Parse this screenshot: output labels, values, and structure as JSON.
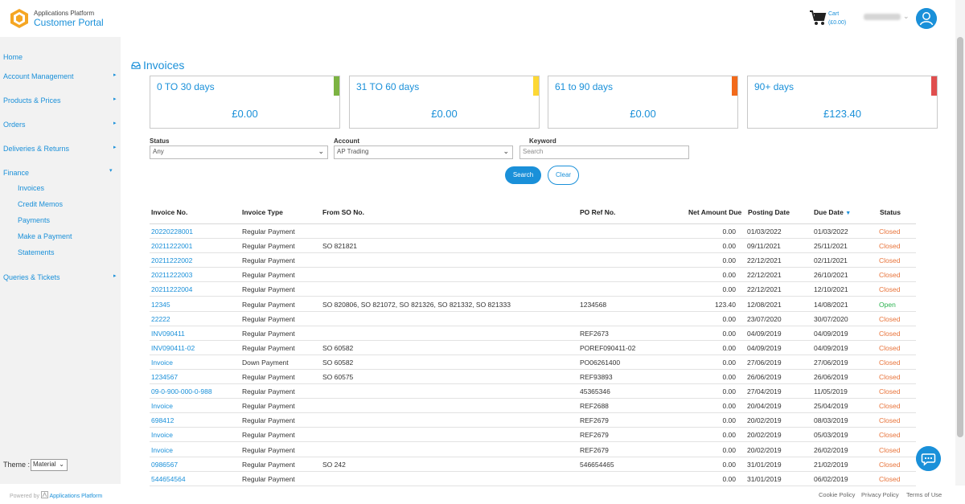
{
  "header": {
    "brand_small": "Applications Platform",
    "brand_big": "Customer Portal",
    "cart_label": "Cart",
    "cart_amount": "(£0.00)"
  },
  "sidebar": {
    "items": [
      {
        "label": "Home",
        "has_arrow": false
      },
      {
        "label": "Account Management",
        "has_arrow": true
      },
      {
        "label": "Products & Prices",
        "has_arrow": true
      },
      {
        "label": "Orders",
        "has_arrow": true
      },
      {
        "label": "Deliveries & Returns",
        "has_arrow": true
      },
      {
        "label": "Finance",
        "expanded": true
      },
      {
        "label": "Queries & Tickets",
        "has_arrow": true
      }
    ],
    "finance_sub": [
      "Invoices",
      "Credit Memos",
      "Payments",
      "Make a Payment",
      "Statements"
    ],
    "theme_label": "Theme :",
    "theme_value": "Material",
    "powered_by": "Powered by",
    "powered_name": "Applications Platform"
  },
  "page": {
    "title": "Invoices"
  },
  "aging": [
    {
      "title": "0 TO 30 days",
      "value": "£0.00",
      "color": "#7cb342"
    },
    {
      "title": "31 TO 60 days",
      "value": "£0.00",
      "color": "#fdd835"
    },
    {
      "title": "61 to 90 days",
      "value": "£0.00",
      "color": "#f26a1b"
    },
    {
      "title": "90+ days",
      "value": "£123.40",
      "color": "#e04e4e"
    }
  ],
  "filters": {
    "status_label": "Status",
    "status_value": "Any",
    "account_label": "Account",
    "account_value": "AP Trading",
    "keyword_label": "Keyword",
    "keyword_placeholder": "Search",
    "search_button": "Search",
    "clear_button": "Clear"
  },
  "table": {
    "headers": {
      "invoice_no": "Invoice No.",
      "invoice_type": "Invoice Type",
      "from_so": "From SO No.",
      "po_ref": "PO Ref No.",
      "net_due": "Net Amount Due",
      "posting_date": "Posting Date",
      "due_date": "Due Date",
      "status": "Status"
    },
    "rows": [
      {
        "inv": "20220228001",
        "type": "Regular Payment",
        "so": "",
        "po": "",
        "net": "0.00",
        "post": "01/03/2022",
        "due": "01/03/2022",
        "status": "Closed"
      },
      {
        "inv": "20211222001",
        "type": "Regular Payment",
        "so": "SO 821821",
        "po": "",
        "net": "0.00",
        "post": "09/11/2021",
        "due": "25/11/2021",
        "status": "Closed"
      },
      {
        "inv": "20211222002",
        "type": "Regular Payment",
        "so": "",
        "po": "",
        "net": "0.00",
        "post": "22/12/2021",
        "due": "02/11/2021",
        "status": "Closed"
      },
      {
        "inv": "20211222003",
        "type": "Regular Payment",
        "so": "",
        "po": "",
        "net": "0.00",
        "post": "22/12/2021",
        "due": "26/10/2021",
        "status": "Closed"
      },
      {
        "inv": "20211222004",
        "type": "Regular Payment",
        "so": "",
        "po": "",
        "net": "0.00",
        "post": "22/12/2021",
        "due": "12/10/2021",
        "status": "Closed"
      },
      {
        "inv": "12345",
        "type": "Regular Payment",
        "so": "SO 820806, SO 821072, SO 821326, SO 821332, SO 821333",
        "po": "1234568",
        "net": "123.40",
        "post": "12/08/2021",
        "due": "14/08/2021",
        "status": "Open"
      },
      {
        "inv": "22222",
        "type": "Regular Payment",
        "so": "",
        "po": "",
        "net": "0.00",
        "post": "23/07/2020",
        "due": "30/07/2020",
        "status": "Closed"
      },
      {
        "inv": "INV090411",
        "type": "Regular Payment",
        "so": "",
        "po": "REF2673",
        "net": "0.00",
        "post": "04/09/2019",
        "due": "04/09/2019",
        "status": "Closed"
      },
      {
        "inv": "INV090411-02",
        "type": "Regular Payment",
        "so": "SO 60582",
        "po": "POREF090411-02",
        "net": "0.00",
        "post": "04/09/2019",
        "due": "04/09/2019",
        "status": "Closed"
      },
      {
        "inv": "Invoice",
        "type": "Down Payment",
        "so": "SO 60582",
        "po": "PO06261400",
        "net": "0.00",
        "post": "27/06/2019",
        "due": "27/06/2019",
        "status": "Closed"
      },
      {
        "inv": "1234567",
        "type": "Regular Payment",
        "so": "SO 60575",
        "po": "REF93893",
        "net": "0.00",
        "post": "26/06/2019",
        "due": "26/06/2019",
        "status": "Closed"
      },
      {
        "inv": "09-0-900-000-0-988",
        "type": "Regular Payment",
        "so": "",
        "po": "45365346",
        "net": "0.00",
        "post": "27/04/2019",
        "due": "11/05/2019",
        "status": "Closed"
      },
      {
        "inv": "Invoice",
        "type": "Regular Payment",
        "so": "",
        "po": "REF2688",
        "net": "0.00",
        "post": "20/04/2019",
        "due": "25/04/2019",
        "status": "Closed"
      },
      {
        "inv": "698412",
        "type": "Regular Payment",
        "so": "",
        "po": "REF2679",
        "net": "0.00",
        "post": "20/02/2019",
        "due": "08/03/2019",
        "status": "Closed"
      },
      {
        "inv": "Invoice",
        "type": "Regular Payment",
        "so": "",
        "po": "REF2679",
        "net": "0.00",
        "post": "20/02/2019",
        "due": "05/03/2019",
        "status": "Closed"
      },
      {
        "inv": "Invoice",
        "type": "Regular Payment",
        "so": "",
        "po": "REF2679",
        "net": "0.00",
        "post": "20/02/2019",
        "due": "26/02/2019",
        "status": "Closed"
      },
      {
        "inv": "0986567",
        "type": "Regular Payment",
        "so": "SO 242",
        "po": "546654465",
        "net": "0.00",
        "post": "31/01/2019",
        "due": "21/02/2019",
        "status": "Closed"
      },
      {
        "inv": "544654564",
        "type": "Regular Payment",
        "so": "",
        "po": "",
        "net": "0.00",
        "post": "31/01/2019",
        "due": "06/02/2019",
        "status": "Closed"
      }
    ]
  },
  "footer": {
    "cookie": "Cookie Policy",
    "privacy": "Privacy Policy",
    "terms": "Terms of Use"
  },
  "colors": {
    "accent": "#1a90d9",
    "closed": "#e8743b",
    "open": "#2ab24e"
  }
}
